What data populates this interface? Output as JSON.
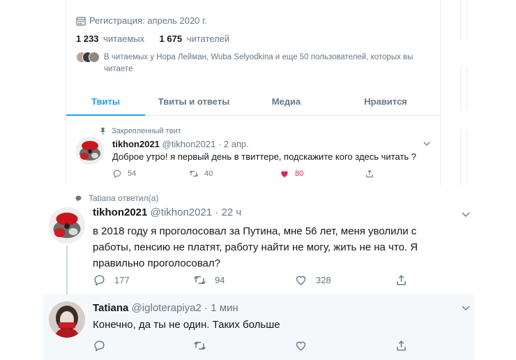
{
  "profile": {
    "joined": "Регистрация: апрель 2020 г.",
    "following_count": "1 233",
    "following_label": "читаемых",
    "followers_count": "1 675",
    "followers_label": "читателей",
    "followed_by": "В читаемых у Нора Лейман, Wuba Selyodkina и еще 50 пользователей, которых вы читаете"
  },
  "tabs": [
    {
      "label": "Твиты",
      "active": true
    },
    {
      "label": "Твиты и ответы",
      "active": false
    },
    {
      "label": "Медиа",
      "active": false
    },
    {
      "label": "Нравится",
      "active": false
    }
  ],
  "pinned_tweet": {
    "pinned_label": "Закрепленный твит",
    "name": "tikhon2021",
    "meta": "@tikhon2021 · 2 апр.",
    "text": "Доброе утро! я первый день в твиттере, подскажите кого здесь читать ?",
    "replies": "54",
    "retweets": "40",
    "likes": "80"
  },
  "thread": {
    "reply_label": "Tatiana ответил(а)",
    "tweet": {
      "name": "tikhon2021",
      "meta": "@tikhon2021 · 22 ч",
      "text": "в 2018 году я проголосовал за Путина, мне 56 лет, меня уволили с работы, пенсию не платят, работу найти не могу, жить не на что. Я правильно проголосовал?",
      "replies": "177",
      "retweets": "94",
      "likes": "328"
    },
    "reply": {
      "name": "Tatiana",
      "meta": "@igloterapiya2 · 1 мин",
      "text": "Конечно, да ты не один. Таких больше"
    }
  },
  "colors": {
    "accent": "#1da1f2",
    "like": "#e0245e",
    "muted": "#657786",
    "reply_bg": "#f5f8fa"
  },
  "icons": [
    "calendar-icon",
    "pin-icon",
    "reply-icon",
    "retweet-icon",
    "heart-icon",
    "share-icon",
    "chevron-down-icon",
    "speech-bubble-icon"
  ]
}
